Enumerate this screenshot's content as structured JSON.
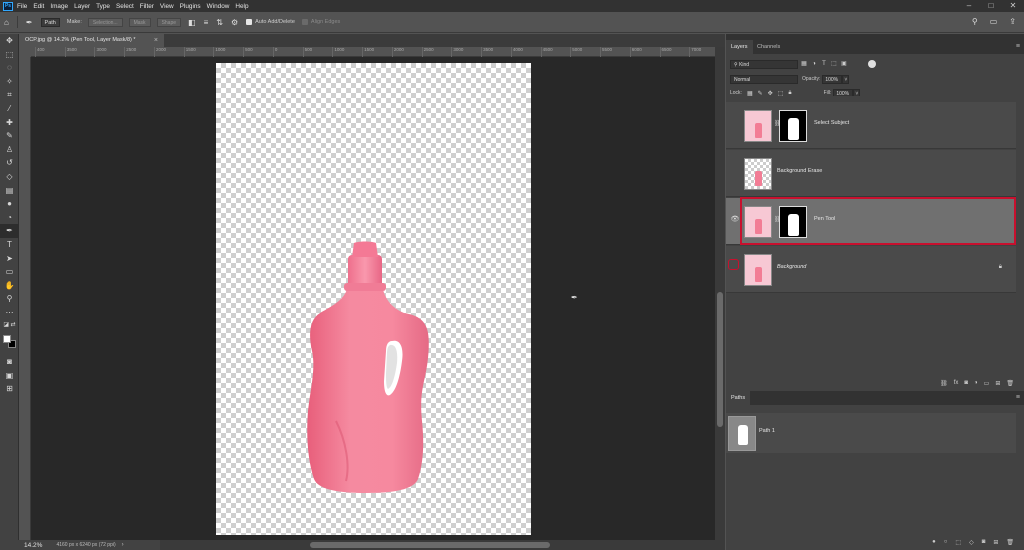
{
  "menubar": {
    "logo": "Ps",
    "items": [
      "File",
      "Edit",
      "Image",
      "Layer",
      "Type",
      "Select",
      "Filter",
      "View",
      "Plugins",
      "Window",
      "Help"
    ],
    "window_controls": [
      "–",
      "□",
      "✕"
    ]
  },
  "options": {
    "mode": "Path",
    "make_label": "Make:",
    "selection_btn": "Selection...",
    "mask_btn": "Mask",
    "shape_btn": "Shape",
    "auto_add_delete": "Auto Add/Delete",
    "align_edges": "Align Edges"
  },
  "document": {
    "tab_title": "OCP.jpg @ 14.2% (Pen Tool, Layer Mask/8) *",
    "zoom": "14.2%",
    "info": "4160 px x 6240 px (72 ppi)"
  },
  "ruler_ticks": [
    "400",
    "3500",
    "3000",
    "2500",
    "2000",
    "1500",
    "1000",
    "500",
    "0",
    "500",
    "1000",
    "1500",
    "2000",
    "2500",
    "3000",
    "3500",
    "4000",
    "4500",
    "5000",
    "5500",
    "6000",
    "6500",
    "7000"
  ],
  "layers_panel": {
    "tabs": [
      "Layers",
      "Channels"
    ],
    "filter_kind": "Kind",
    "blend_mode": "Normal",
    "opacity_label": "Opacity:",
    "opacity": "100%",
    "lock_label": "Lock:",
    "fill_label": "Fill:",
    "fill": "100%",
    "layers": [
      {
        "name": "Select Subject",
        "visible": false,
        "has_mask": true
      },
      {
        "name": "Background Erase",
        "visible": false,
        "has_mask": false
      },
      {
        "name": "Pen Tool",
        "visible": true,
        "has_mask": true,
        "selected": true
      },
      {
        "name": "Background",
        "visible": false,
        "has_mask": false,
        "locked": true
      }
    ]
  },
  "paths_panel": {
    "tab": "Paths",
    "paths": [
      {
        "name": "Path 1"
      }
    ]
  },
  "colors": {
    "bottle": "#f27d95",
    "highlight": "#c8102e",
    "accent": "#31a8ff"
  }
}
